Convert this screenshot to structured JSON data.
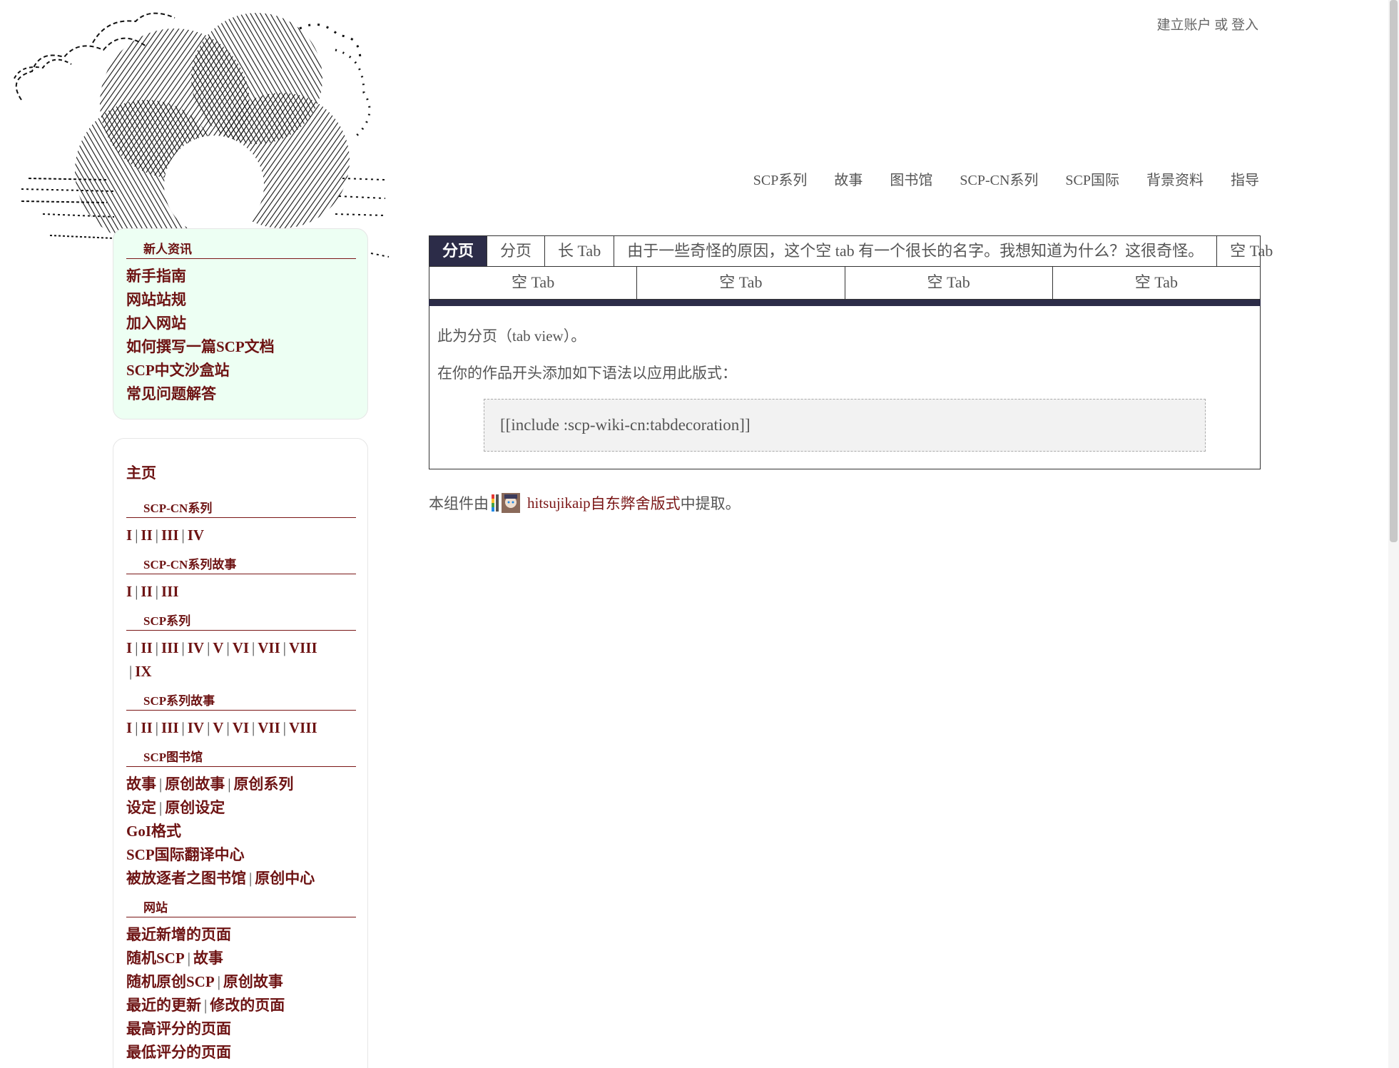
{
  "account": {
    "create": "建立账户",
    "or": "或",
    "login": "登入"
  },
  "topnav": [
    "SCP系列",
    "故事",
    "图书馆",
    "SCP-CN系列",
    "SCP国际",
    "背景资料",
    "指导"
  ],
  "panel_new": {
    "heading": "新人资讯",
    "links": [
      "新手指南",
      "网站站规",
      "加入网站",
      "如何撰写一篇SCP文档",
      "SCP中文沙盒站",
      "常见问题解答"
    ]
  },
  "panel_main": {
    "title": "主页",
    "cn_series": {
      "heading": "SCP-CN系列",
      "items": [
        "I",
        "II",
        "III",
        "IV"
      ]
    },
    "cn_tales": {
      "heading": "SCP-CN系列故事",
      "items": [
        "I",
        "II",
        "III"
      ]
    },
    "series": {
      "heading": "SCP系列",
      "items": [
        "I",
        "II",
        "III",
        "IV",
        "V",
        "VI",
        "VII",
        "VIII",
        "IX"
      ]
    },
    "series_tales": {
      "heading": "SCP系列故事",
      "items": [
        "I",
        "II",
        "III",
        "IV",
        "V",
        "VI",
        "VII",
        "VIII"
      ]
    },
    "library": {
      "heading": "SCP图书馆",
      "row1": [
        "故事",
        "原创故事",
        "原创系列"
      ],
      "row2": [
        "设定",
        "原创设定"
      ],
      "row3": "GoI格式",
      "row4": "SCP国际翻译中心",
      "row5": [
        "被放逐者之图书馆",
        "原创中心"
      ]
    },
    "site": {
      "heading": "网站",
      "row1": "最近新增的页面",
      "row2": [
        "随机SCP",
        "故事"
      ],
      "row3": [
        "随机原创SCP",
        "原创故事"
      ],
      "row4": [
        "最近的更新",
        "修改的页面"
      ],
      "row5": "最高评分的页面",
      "row6": "最低评分的页面"
    }
  },
  "tabs": {
    "row1": [
      "分页",
      "分页",
      "长 Tab",
      "由于一些奇怪的原因，这个空 tab 有一个很长的名字。我想知道为什么？这很奇怪。",
      "空 Tab"
    ],
    "row2": [
      "空 Tab",
      "空 Tab",
      "空 Tab",
      "空 Tab"
    ],
    "content": {
      "line1": "此为分页（tab view）。",
      "line2": "在你的作品开头添加如下语法以应用此版式：",
      "code": "[[include :scp-wiki-cn:tabdecoration]]"
    }
  },
  "credit": {
    "prefix": "本组件由",
    "author": "hitsujikaip",
    "from": "自",
    "source": "东弊舍版式",
    "suffix": "中提取。"
  }
}
